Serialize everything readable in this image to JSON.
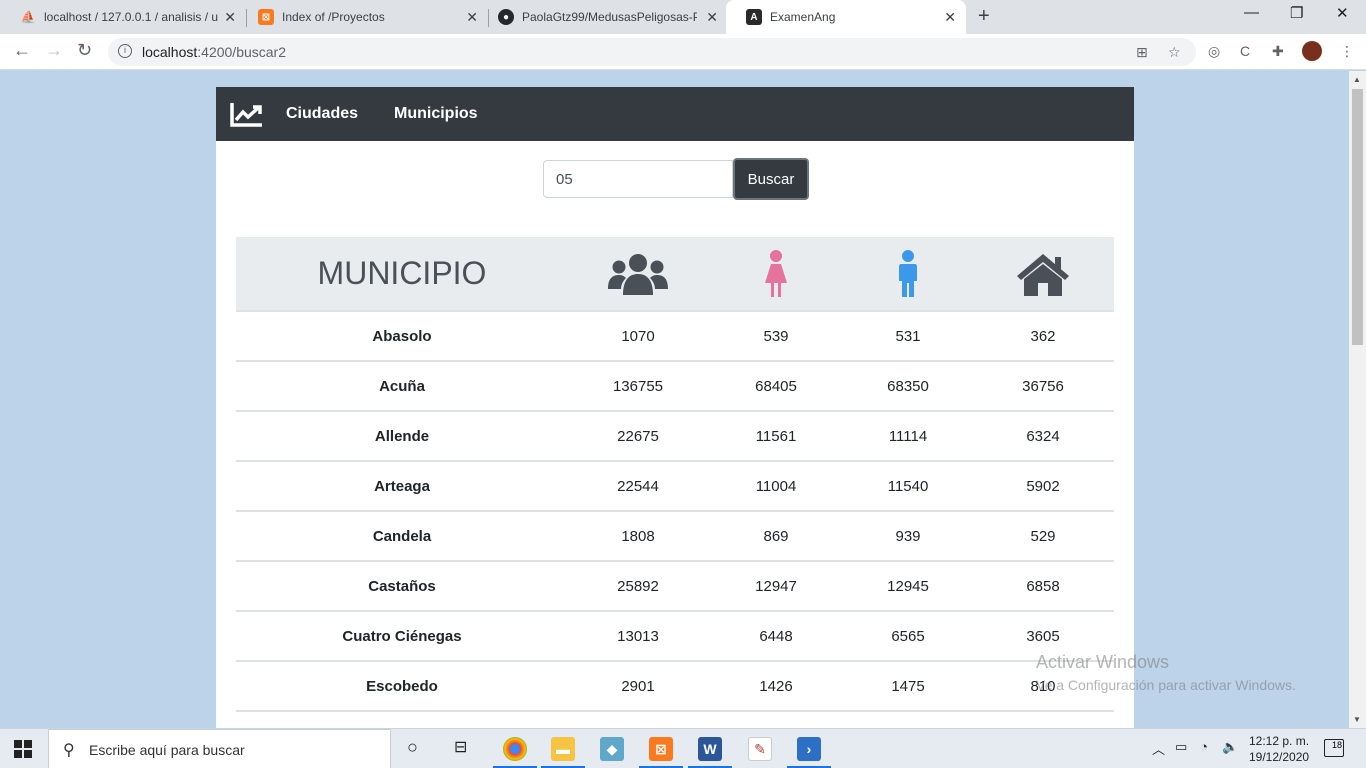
{
  "browser": {
    "tabs": [
      {
        "label": "localhost / 127.0.0.1 / analisis / u",
        "icon": "phpmyadmin-icon"
      },
      {
        "label": "Index of /Proyectos",
        "icon": "xampp-icon"
      },
      {
        "label": "PaolaGtz99/MedusasPeligosas-Pl",
        "icon": "github-icon"
      },
      {
        "label": "ExamenAng",
        "icon": "angular-icon"
      }
    ],
    "url_host": "localhost",
    "url_path": ":4200/buscar2"
  },
  "nav": {
    "brand_icon": "chart-line-icon",
    "links": [
      "Ciudades",
      "Municipios"
    ]
  },
  "search": {
    "value": "05",
    "button": "Buscar"
  },
  "table": {
    "header_label": "MUNICIPIO",
    "header_icons": [
      "users-icon",
      "female-icon",
      "male-icon",
      "home-icon"
    ],
    "colors": {
      "female": "#e5739b",
      "male": "#3c98e8",
      "header_icon": "#495057"
    },
    "rows": [
      {
        "name": "Abasolo",
        "total": "1070",
        "women": "539",
        "men": "531",
        "homes": "362"
      },
      {
        "name": "Acuña",
        "total": "136755",
        "women": "68405",
        "men": "68350",
        "homes": "36756"
      },
      {
        "name": "Allende",
        "total": "22675",
        "women": "11561",
        "men": "11114",
        "homes": "6324"
      },
      {
        "name": "Arteaga",
        "total": "22544",
        "women": "11004",
        "men": "11540",
        "homes": "5902"
      },
      {
        "name": "Candela",
        "total": "1808",
        "women": "869",
        "men": "939",
        "homes": "529"
      },
      {
        "name": "Castaños",
        "total": "25892",
        "women": "12947",
        "men": "12945",
        "homes": "6858"
      },
      {
        "name": "Cuatro Ciénegas",
        "total": "13013",
        "women": "6448",
        "men": "6565",
        "homes": "3605"
      },
      {
        "name": "Escobedo",
        "total": "2901",
        "women": "1426",
        "men": "1475",
        "homes": "810"
      }
    ]
  },
  "watermark": {
    "line1": "Activar Windows",
    "line2": "Ve a Configuración para activar Windows."
  },
  "taskbar": {
    "search_placeholder": "Escribe aquí para buscar",
    "time": "12:12 p. m.",
    "date": "19/12/2020",
    "notifications": "18"
  }
}
